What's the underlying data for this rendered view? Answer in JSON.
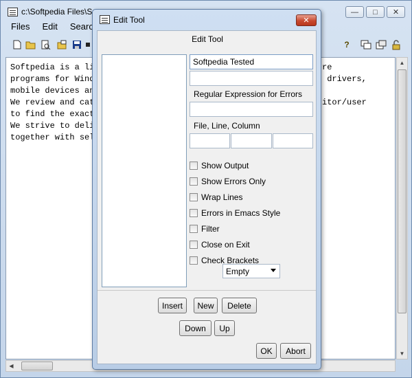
{
  "main_window": {
    "title": "c:\\Softpedia Files\\So",
    "controls": {
      "minimize": "—",
      "maximize": "□",
      "close": "✕"
    },
    "menu": [
      "Files",
      "Edit",
      "Search"
    ],
    "toolbar_icons": [
      "new-file-icon",
      "open-folder-icon",
      "print-preview-icon",
      "open-recent-icon",
      "save-icon",
      "small-square-icon",
      "help-icon",
      "windows-icon",
      "window-restore-icon",
      "lock-icon"
    ],
    "editor_lines": [
      "Softpedia is a li",
      "programs for Wind",
      "mobile devices an",
      "We review and cat",
      "to find the exact",
      "We strive to deli",
      "together with sel"
    ],
    "editor_lines_right": [
      "re",
      " drivers,",
      "",
      "itor/user",
      "",
      "",
      ""
    ]
  },
  "dialog": {
    "title": "Edit Tool",
    "close_label": "✕",
    "heading": "Edit Tool",
    "name_value": "Softpedia Tested",
    "second_field_value": "",
    "regex_label": "Regular Expression for Errors",
    "regex_value": "",
    "flc_label": "File, Line, Column",
    "checkboxes": [
      {
        "label": "Show Output",
        "checked": false
      },
      {
        "label": "Show Errors Only",
        "checked": false
      },
      {
        "label": "Wrap Lines",
        "checked": false
      },
      {
        "label": "Errors in Emacs Style",
        "checked": false
      },
      {
        "label": "Filter",
        "checked": false
      },
      {
        "label": "Close on Exit",
        "checked": false
      },
      {
        "label": "Check Brackets",
        "checked": false
      }
    ],
    "dropdown_value": "Empty",
    "buttons": {
      "insert": "Insert",
      "new": "New",
      "delete": "Delete",
      "down": "Down",
      "up": "Up",
      "ok": "OK",
      "abort": "Abort"
    }
  }
}
